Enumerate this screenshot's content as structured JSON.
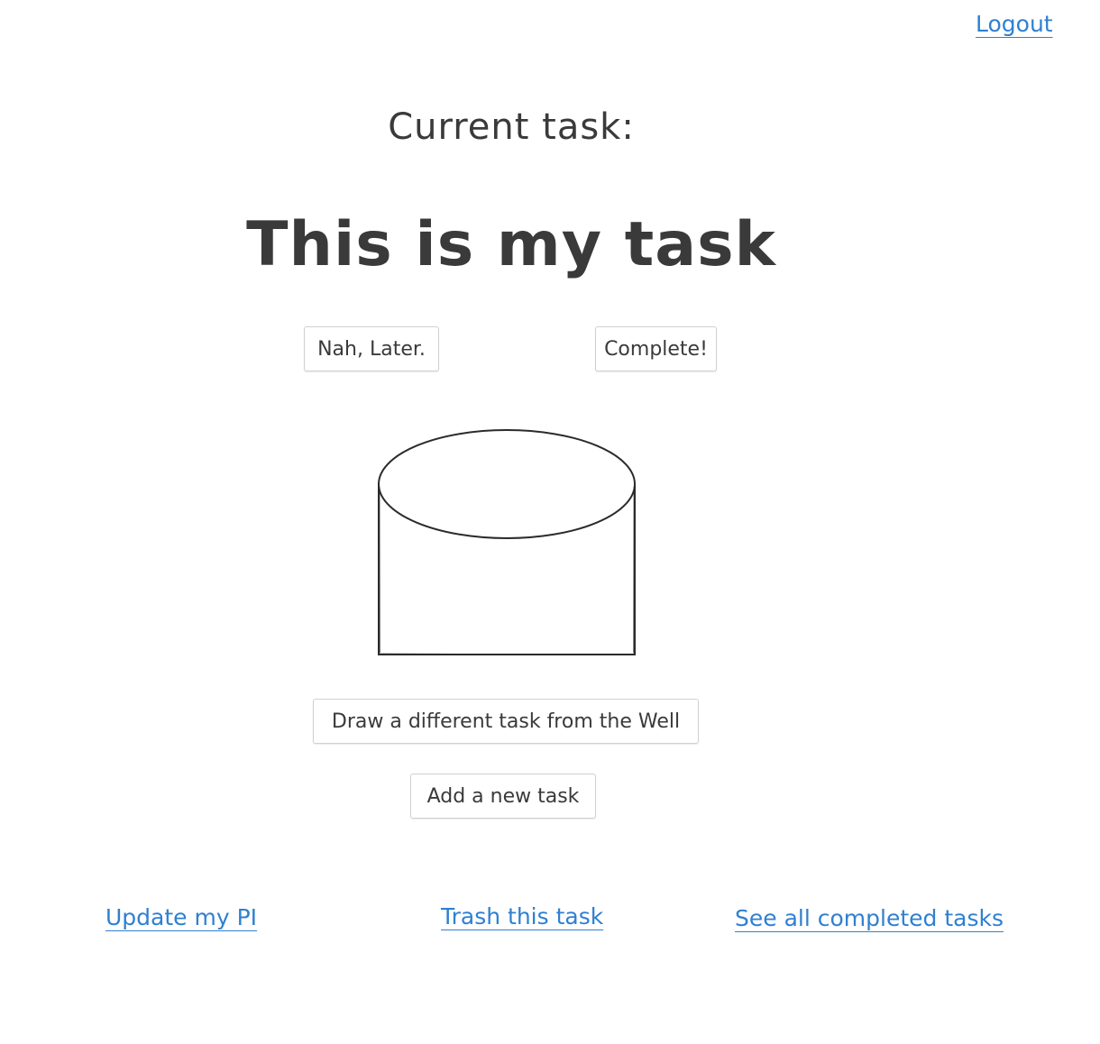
{
  "header": {
    "logout_label": "Logout"
  },
  "main": {
    "current_task_label": "Current task:",
    "task_title": "This is my task",
    "later_button_label": "Nah, Later.",
    "complete_button_label": "Complete!",
    "draw_button_label": "Draw a different task from the Well",
    "add_button_label": "Add a new task"
  },
  "footer": {
    "update_pi_label": "Update my PI",
    "trash_label": "Trash this task",
    "completed_label": "See all completed tasks"
  },
  "colors": {
    "link": "#2f80d1",
    "text": "#3a3a3a",
    "button_border": "#d0d0d0",
    "background": "#ffffff"
  },
  "icons": {
    "well": "well-cylinder-icon"
  }
}
